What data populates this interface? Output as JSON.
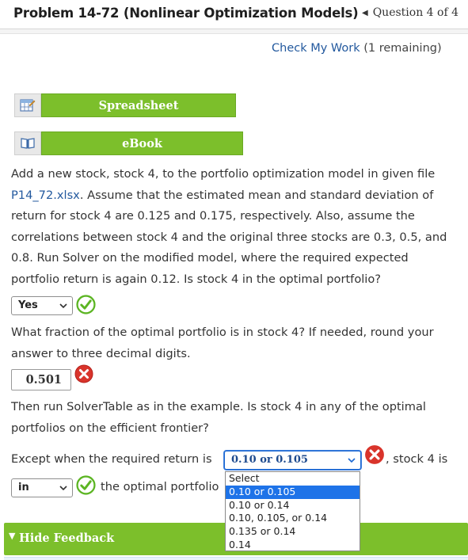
{
  "header": {
    "title": "Problem 14-72 (Nonlinear Optimization Models)",
    "question_nav": "Question 4 of 4"
  },
  "check": {
    "link": "Check My Work",
    "remaining": "(1 remaining)"
  },
  "buttons": {
    "spreadsheet": "Spreadsheet",
    "ebook": "eBook"
  },
  "problem": {
    "line1": "Add a new stock, stock 4, to the portfolio optimization model in given file",
    "file": "P14_72.xlsx",
    "line2_rest": ". Assume that the estimated mean and standard deviation of",
    "line3": "return for stock 4 are 0.125 and 0.175, respectively. Also, assume the",
    "line4": "correlations between stock 4 and the original three stocks are 0.3, 0.5, and",
    "line5": "0.8. Run Solver on the modified model, where the required expected",
    "line6": "portfolio return is again 0.12. Is stock 4 in the optimal portfolio?"
  },
  "q1": {
    "value": "Yes",
    "status": "correct"
  },
  "q2": {
    "line1": "What fraction of the optimal portfolio is in stock 4? If needed, round your",
    "line2": "answer to three decimal digits.",
    "value": "0.501",
    "status": "incorrect"
  },
  "q3": {
    "line1": "Then run SolverTable as in the example. Is stock 4 in any of the optimal",
    "line2": "portfolios on the efficient frontier?",
    "prefix": "Except when the required return is",
    "value": "0.10 or 0.105",
    "suffix": ", stock 4 is",
    "status": "incorrect",
    "options": [
      "Select",
      "0.10 or 0.105",
      "0.10 or 0.14",
      "0.10, 0.105, or 0.14",
      "0.135 or 0.14",
      "0.14"
    ]
  },
  "q4": {
    "value": "in",
    "suffix": "the optimal portfolio",
    "status": "correct"
  },
  "feedback": {
    "label": "Hide Feedback"
  },
  "colors": {
    "accent_green": "#7cbf2b",
    "link_blue": "#23599e",
    "error_red": "#d9342b",
    "ok_green": "#5cb523"
  }
}
